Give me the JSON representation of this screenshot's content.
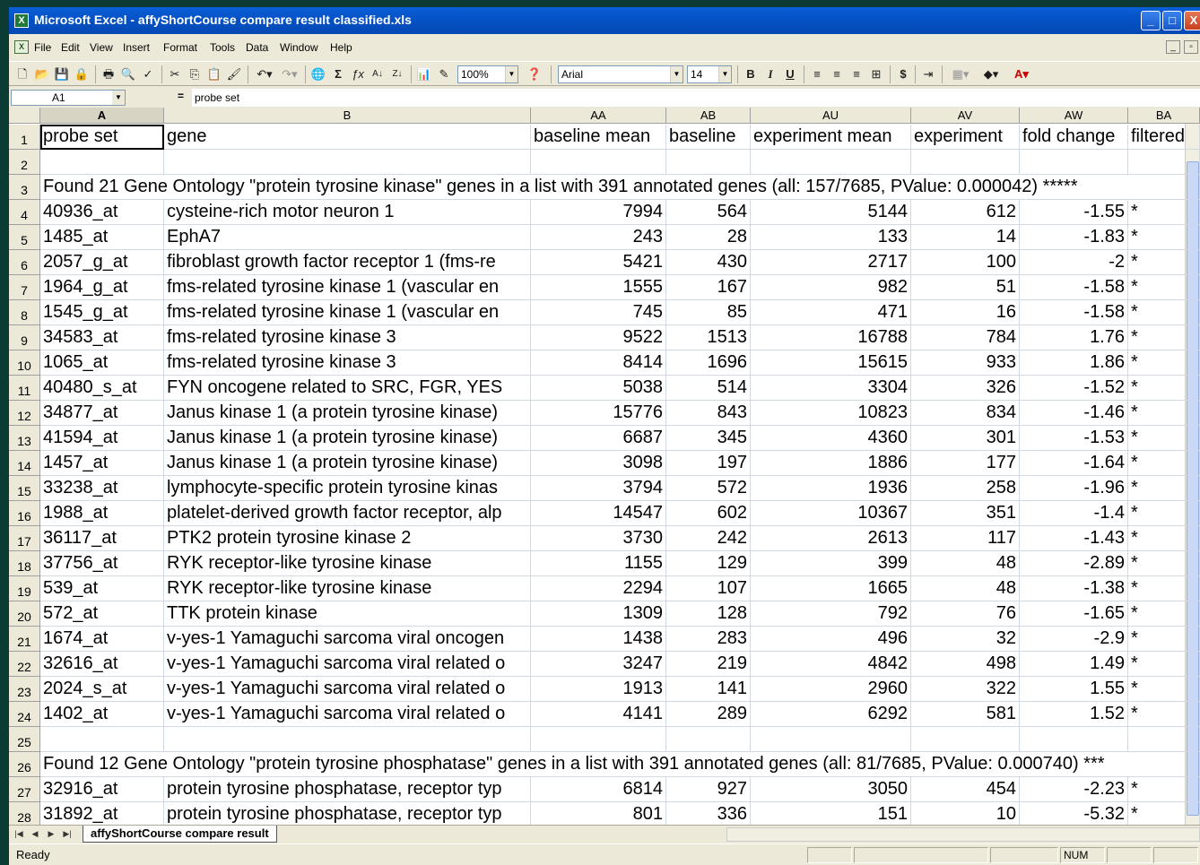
{
  "window": {
    "title": "Microsoft Excel - affyShortCourse compare result classified.xls",
    "app_icon": "excel-icon"
  },
  "menu": [
    "File",
    "Edit",
    "View",
    "Insert",
    "Format",
    "Tools",
    "Data",
    "Window",
    "Help"
  ],
  "toolbar": {
    "zoom": "100%",
    "font": "Arial",
    "size": "14"
  },
  "formula_bar": {
    "name_box": "A1",
    "eq": "=",
    "content": "probe set"
  },
  "grid": {
    "columns": [
      "A",
      "B",
      "AA",
      "AB",
      "AU",
      "AV",
      "AW",
      "BA"
    ],
    "header": [
      "probe set",
      "gene",
      "baseline mean",
      "baseline",
      "experiment mean",
      "experiment",
      "fold change",
      "filtered"
    ],
    "row_numbers": [
      "1",
      "2",
      "3",
      "4",
      "5",
      "6",
      "7",
      "8",
      "9",
      "10",
      "11",
      "12",
      "13",
      "14",
      "15",
      "16",
      "17",
      "18",
      "19",
      "20",
      "21",
      "22",
      "23",
      "24",
      "25",
      "26",
      "27",
      "28"
    ],
    "section1_label": "Found 21 Gene Ontology \"protein tyrosine kinase\" genes in a list with 391 annotated genes (all: 157/7685, PValue: 0.000042) *****",
    "section2_label": "Found 12 Gene Ontology \"protein tyrosine phosphatase\" genes in a list with 391 annotated genes (all: 81/7685, PValue: 0.000740) ***",
    "rows1": [
      [
        "40936_at",
        "cysteine-rich motor neuron 1",
        "7994",
        "564",
        "5144",
        "612",
        "-1.55",
        "*"
      ],
      [
        "1485_at",
        "EphA7",
        "243",
        "28",
        "133",
        "14",
        "-1.83",
        "*"
      ],
      [
        "2057_g_at",
        "fibroblast growth factor receptor 1 (fms-re",
        "5421",
        "430",
        "2717",
        "100",
        "-2",
        "*"
      ],
      [
        "1964_g_at",
        "fms-related tyrosine kinase 1 (vascular en",
        "1555",
        "167",
        "982",
        "51",
        "-1.58",
        "*"
      ],
      [
        "1545_g_at",
        "fms-related tyrosine kinase 1 (vascular en",
        "745",
        "85",
        "471",
        "16",
        "-1.58",
        "*"
      ],
      [
        "34583_at",
        "fms-related tyrosine kinase 3",
        "9522",
        "1513",
        "16788",
        "784",
        "1.76",
        "*"
      ],
      [
        "1065_at",
        "fms-related tyrosine kinase 3",
        "8414",
        "1696",
        "15615",
        "933",
        "1.86",
        "*"
      ],
      [
        "40480_s_at",
        "FYN oncogene related to SRC, FGR, YES",
        "5038",
        "514",
        "3304",
        "326",
        "-1.52",
        "*"
      ],
      [
        "34877_at",
        "Janus kinase 1 (a protein tyrosine kinase)",
        "15776",
        "843",
        "10823",
        "834",
        "-1.46",
        "*"
      ],
      [
        "41594_at",
        "Janus kinase 1 (a protein tyrosine kinase)",
        "6687",
        "345",
        "4360",
        "301",
        "-1.53",
        "*"
      ],
      [
        "1457_at",
        "Janus kinase 1 (a protein tyrosine kinase)",
        "3098",
        "197",
        "1886",
        "177",
        "-1.64",
        "*"
      ],
      [
        "33238_at",
        "lymphocyte-specific protein tyrosine kinas",
        "3794",
        "572",
        "1936",
        "258",
        "-1.96",
        "*"
      ],
      [
        "1988_at",
        "platelet-derived growth factor receptor, alp",
        "14547",
        "602",
        "10367",
        "351",
        "-1.4",
        "*"
      ],
      [
        "36117_at",
        "PTK2 protein tyrosine kinase 2",
        "3730",
        "242",
        "2613",
        "117",
        "-1.43",
        "*"
      ],
      [
        "37756_at",
        "RYK receptor-like tyrosine kinase",
        "1155",
        "129",
        "399",
        "48",
        "-2.89",
        "*"
      ],
      [
        "539_at",
        "RYK receptor-like tyrosine kinase",
        "2294",
        "107",
        "1665",
        "48",
        "-1.38",
        "*"
      ],
      [
        "572_at",
        "TTK protein kinase",
        "1309",
        "128",
        "792",
        "76",
        "-1.65",
        "*"
      ],
      [
        "1674_at",
        "v-yes-1 Yamaguchi sarcoma viral oncogen",
        "1438",
        "283",
        "496",
        "32",
        "-2.9",
        "*"
      ],
      [
        "32616_at",
        "v-yes-1 Yamaguchi sarcoma viral related o",
        "3247",
        "219",
        "4842",
        "498",
        "1.49",
        "*"
      ],
      [
        "2024_s_at",
        "v-yes-1 Yamaguchi sarcoma viral related o",
        "1913",
        "141",
        "2960",
        "322",
        "1.55",
        "*"
      ],
      [
        "1402_at",
        "v-yes-1 Yamaguchi sarcoma viral related o",
        "4141",
        "289",
        "6292",
        "581",
        "1.52",
        "*"
      ]
    ],
    "rows2": [
      [
        "32916_at",
        "protein tyrosine phosphatase, receptor typ",
        "6814",
        "927",
        "3050",
        "454",
        "-2.23",
        "*"
      ],
      [
        "31892_at",
        "protein tyrosine phosphatase, receptor typ",
        "801",
        "336",
        "151",
        "10",
        "-5.32",
        "*"
      ]
    ]
  },
  "sheet_tab": "affyShortCourse compare result",
  "status": {
    "text": "Ready",
    "num": "NUM"
  }
}
